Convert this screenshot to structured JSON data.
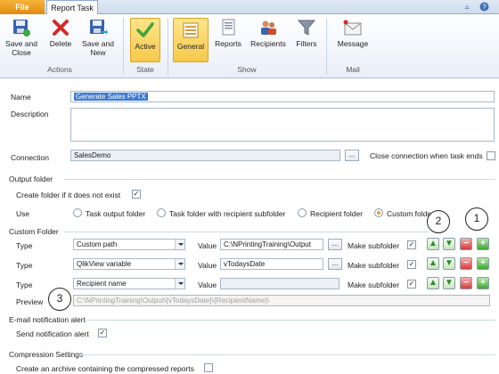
{
  "tabs": {
    "file": "File",
    "report_task": "Report Task"
  },
  "ribbon": {
    "save_close": "Save and Close",
    "delete": "Delete",
    "save_new": "Save and New",
    "active": "Active",
    "general": "General",
    "reports": "Reports",
    "recipients": "Recipients",
    "filters": "Filters",
    "message": "Message",
    "groups": {
      "actions": "Actions",
      "state": "State",
      "show": "Show",
      "mail": "Mail"
    }
  },
  "form": {
    "name_label": "Name",
    "name_value": "Generate Sales PPTX",
    "description_label": "Description",
    "connection_label": "Connection",
    "connection_value": "SalesDemo",
    "close_connection": "Close connection when task ends",
    "output_folder": "Output  folder",
    "create_folder": "Create folder if it does not exist",
    "use_label": "Use",
    "use_options": [
      "Task output folder",
      "Task folder with recipient subfolder",
      "Recipient folder",
      "Custom folder"
    ],
    "custom_folder": "Custom Folder",
    "rows": [
      {
        "type_label": "Type",
        "type": "Custom path",
        "value_label": "Value",
        "value": "C:\\NPrintingTraining\\Output",
        "make_sub": "Make subfolder"
      },
      {
        "type_label": "Type",
        "type": "QlikView variable",
        "value_label": "Value",
        "value": "vTodaysDate",
        "make_sub": "Make subfolder"
      },
      {
        "type_label": "Type",
        "type": "Recipient name",
        "value_label": "Value",
        "value": "",
        "make_sub": "Make subfolder"
      }
    ],
    "preview_label": "Preview",
    "preview_value": "C:\\NPrintingTraining\\Output\\{vTodaysDate}\\{RecipientName}\\",
    "email_section": "E-mail notification alert",
    "send_alert": "Send notification alert",
    "compression_section": "Compression Settings",
    "create_archive": "Create an archive containing the compressed reports"
  },
  "callouts": [
    "2",
    "1",
    "3"
  ],
  "colors": {
    "accent_orange": "#f0a01a",
    "ribbon_blue": "#cfdcee",
    "selected_blue": "#3a7ad5"
  }
}
